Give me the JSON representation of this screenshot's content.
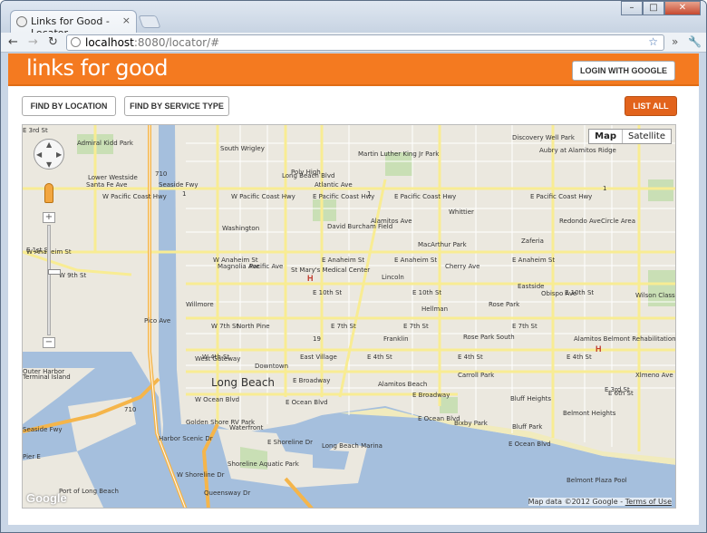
{
  "browser": {
    "tab_title": "Links for Good - Locator",
    "close_tab": "×",
    "url_host": "localhost",
    "url_path": ":8080/locator/#",
    "back": "←",
    "forward": "→",
    "reload": "↻",
    "star": "☆",
    "more": "»",
    "wrench": "🔧",
    "win_min": "–",
    "win_max": "□",
    "win_close": "✕"
  },
  "header": {
    "logo": "links for good",
    "login_label": "LOGIN WITH GOOGLE"
  },
  "toolbar": {
    "find_location": "FIND BY LOCATION",
    "find_service": "FIND BY SERVICE TYPE",
    "list_all": "LIST ALL"
  },
  "map": {
    "type_map": "Map",
    "type_satellite": "Satellite",
    "copyright": "Map data ©2012 Google",
    "terms": "Terms of Use",
    "google": "Google",
    "zoom_in": "+",
    "zoom_out": "−",
    "labels": [
      "Admiral Kidd Park",
      "South Wrigley",
      "Poly High",
      "Martin Luther King Jr Park",
      "Discovery Well Park",
      "Aubry at Alamitos Ridge",
      "Lower Westside",
      "W Pacific Coast Hwy",
      "W Pacific Coast Hwy",
      "E Pacific Coast Hwy",
      "E Pacific Coast Hwy",
      "E Pacific Coast Hwy",
      "Whittier",
      "Washington",
      "David Burcham Field",
      "Circle Area",
      "Zaferia",
      "MacArthur Park",
      "W Anaheim St",
      "W Anaheim St",
      "E Anaheim St",
      "E Anaheim St",
      "E Anaheim St",
      "E 1st St",
      "St Mary's Medical Center",
      "Lincoln",
      "Eastside",
      "W 9th St",
      "E 10th St",
      "E 10th St",
      "E 10th St",
      "Willmore",
      "Hellman",
      "Rose Park",
      "Wilson Classical High School",
      "W 7th St",
      "North Pine",
      "E 7th St",
      "E 7th St",
      "E 7th St",
      "Franklin",
      "Rose Park South",
      "Alamitos Belmont Rehabilitation Hospital",
      "West Gateway",
      "Downtown",
      "East Village",
      "W 4th St",
      "E 4th St",
      "E 4th St",
      "E 4th St",
      "Long Beach",
      "E Broadway",
      "Carroll Park",
      "Alamitos Beach",
      "E Broadway",
      "E 3rd St",
      "Bluff Heights",
      "Terminal Island",
      "W Ocean Blvd",
      "E Ocean Blvd",
      "E Ocean Blvd",
      "Bixby Park",
      "Belmont Heights",
      "Golden Shore RV Park",
      "Waterfront",
      "Bluff Park",
      "E Ocean Blvd",
      "E Shoreline Dr",
      "Long Beach Marina",
      "Seaside Fwy",
      "Shoreline Aquatic Park",
      "Port of Long Beach",
      "Belmont Plaza Pool",
      "Harbor Scenic Dr",
      "Queensway Dr",
      "W Shoreline Dr",
      "Santa Fe Ave",
      "Magnolia Ave",
      "Pacific Ave",
      "Long Beach Blvd",
      "Atlantic Ave",
      "Alamitos Ave",
      "Cherry Ave",
      "Redondo Ave",
      "Obispo Ave",
      "Xlmeno Ave",
      "Pico Ave",
      "Seaside Fwy",
      "Outer Harbor",
      "Pier E",
      "710",
      "710",
      "1",
      "1",
      "1",
      "19",
      "E 6th St",
      "E 3rd St"
    ]
  }
}
